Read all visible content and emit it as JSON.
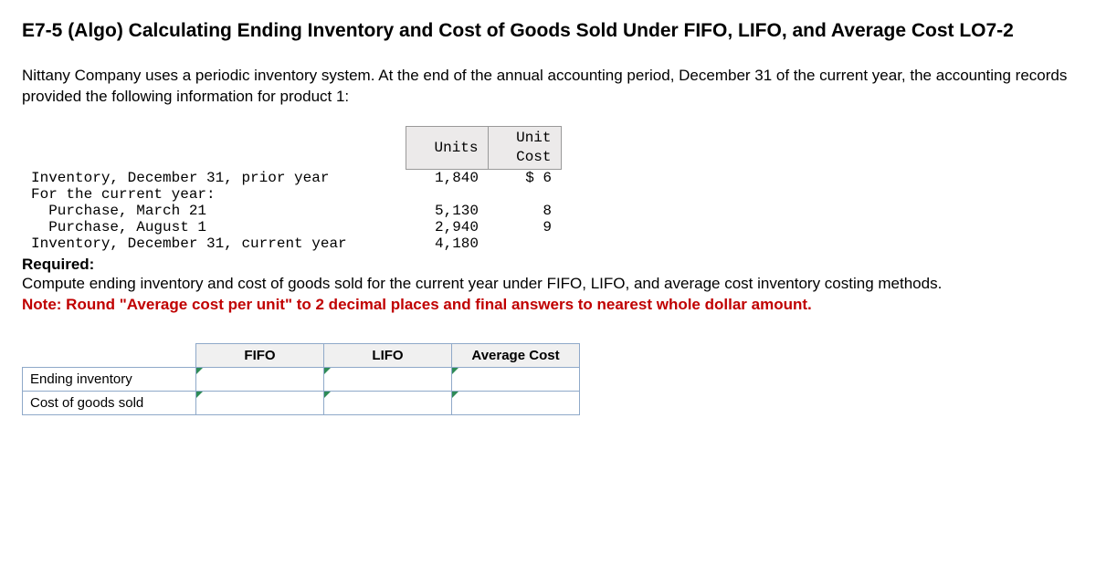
{
  "title": "E7-5 (Algo) Calculating Ending Inventory and Cost of Goods Sold Under FIFO, LIFO, and Average Cost LO7-2",
  "description": "Nittany Company uses a periodic inventory system. At the end of the annual accounting period, December 31 of the current year, the accounting records provided the following information for product 1:",
  "table": {
    "headers": {
      "units": "Units",
      "unit_cost": "Unit\nCost"
    },
    "rows": [
      {
        "desc": "Inventory, December 31, prior year",
        "units": "1,840",
        "cost": "$ 6"
      },
      {
        "desc": "For the current year:",
        "units": "",
        "cost": ""
      },
      {
        "desc": "  Purchase, March 21",
        "units": "5,130",
        "cost": "8"
      },
      {
        "desc": "  Purchase, August 1",
        "units": "2,940",
        "cost": "9"
      },
      {
        "desc": "Inventory, December 31, current year",
        "units": "4,180",
        "cost": ""
      }
    ]
  },
  "required_label": "Required:",
  "required_text": "Compute ending inventory and cost of goods sold for the current year under FIFO, LIFO, and average cost inventory costing methods.",
  "note_text": "Note: Round \"Average cost per unit\" to 2 decimal places and final answers to nearest whole dollar amount.",
  "answer_table": {
    "col_headers": {
      "fifo": "FIFO",
      "lifo": "LIFO",
      "avg": "Average Cost"
    },
    "row_labels": {
      "ending": "Ending inventory",
      "cogs": "Cost of goods sold"
    }
  }
}
